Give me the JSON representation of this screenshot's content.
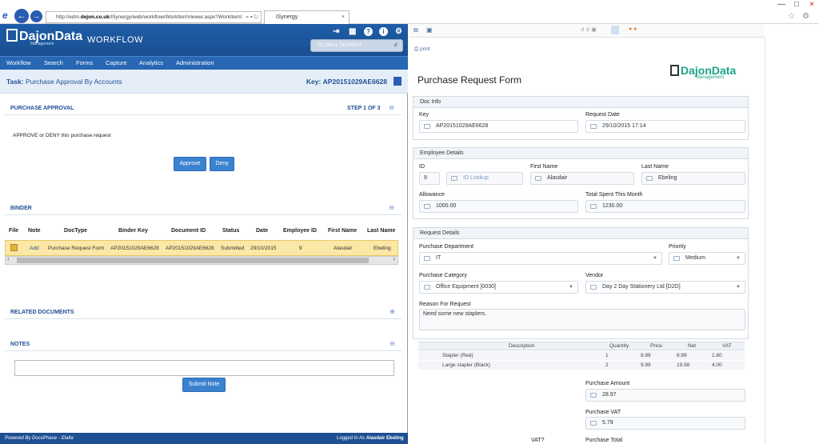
{
  "browser": {
    "url_prefix": "http://edm.",
    "url_domain": "dejon.co.uk",
    "url_rest": "/iSynergy/web/workflow/WorkItemViewer.aspx?WorkItemI",
    "search_glyph": "⌕ ▾ ↻",
    "tab_title": "iSynergy",
    "tab_close": "×"
  },
  "app": {
    "logo_text": "DajonData",
    "logo_sub": "Management",
    "module": "WORKFLOW",
    "global_search_placeholder": "GLOBAL SEARCH"
  },
  "menu": [
    "Workflow",
    "Search",
    "Forms",
    "Capture",
    "Analytics",
    "Administration"
  ],
  "task": {
    "label": "Task:",
    "name": "Purchase Approval By Accounts",
    "key_label": "Key:",
    "key_value": "AP20151029AE6628"
  },
  "approval": {
    "title": "PURCHASE APPROVAL",
    "step": "STEP 1 OF 3",
    "prompt": "APPROVE or DENY this purchase request",
    "approve": "Approve",
    "deny": "Deny"
  },
  "binder": {
    "title": "BINDER",
    "columns": [
      "File",
      "Note",
      "DocType",
      "Binder Key",
      "Document ID",
      "Status",
      "Date",
      "Employee ID",
      "First Name",
      "Last Name"
    ],
    "row": {
      "note": "Add",
      "doctype": "Purchase Request Form",
      "binder_key": "AP20151029AE6628",
      "document_id": "AP20151029AE6628",
      "status": "Submitted",
      "date": "29/10/2015",
      "employee_id": "9",
      "first_name": "Alasdair",
      "last_name": "Ebeling"
    }
  },
  "related": {
    "title": "RELATED DOCUMENTS"
  },
  "notes": {
    "title": "NOTES",
    "submit": "Submit Note"
  },
  "footer": {
    "left": "Powered By DocuPhase - iDalta",
    "right_label": "Logged In As",
    "user": "Alasdair Ebeling"
  },
  "form": {
    "print": "print",
    "title": "Purchase Request Form",
    "logo_text": "DajonData",
    "logo_sub": "Management",
    "doc_info": {
      "title": "Doc Info",
      "key_label": "Key",
      "key": "AP20151029AE6628",
      "date_label": "Request Date",
      "date": "29/10/2015 17:14"
    },
    "employee": {
      "title": "Employee Details",
      "id_label": "ID",
      "id": "9",
      "lookup": "ID Lookup",
      "first_label": "First Name",
      "first": "Alasdair",
      "last_label": "Last Name",
      "last": "Ebeling",
      "allowance_label": "Allowance",
      "allowance": "1000.00",
      "spent_label": "Total Spent This Month",
      "spent": "1230.00"
    },
    "request": {
      "title": "Request Details",
      "dept_label": "Purchase Department",
      "dept": "IT",
      "priority_label": "Priority",
      "priority": "Medium",
      "category_label": "Purchase Category",
      "category": "Office Equipment [0030]",
      "vendor_label": "Vendor",
      "vendor": "Day 2 Day Stationery Ltd [D2D]",
      "reason_label": "Reason For Request",
      "reason": "Need some new staplers."
    },
    "items": {
      "columns": [
        "Description",
        "Quantity",
        "Price",
        "Net",
        "VAT"
      ],
      "rows": [
        {
          "description": "Stapler (Red)",
          "quantity": "1",
          "price": "8.99",
          "net": "8.99",
          "vat": "1.80"
        },
        {
          "description": "Large stapler (Black)",
          "quantity": "2",
          "price": "9.99",
          "net": "19.98",
          "vat": "4.00"
        }
      ]
    },
    "amount_label": "Purchase Amount",
    "amount": "28.97",
    "vat_label": "Purchase VAT",
    "vat": "5.79",
    "vatq_label": "VAT?",
    "total_label": "Purchase Total"
  },
  "colors": {
    "brand": "#1e5da8",
    "menu": "#2767b4",
    "highlight_row": "#fbe7a6",
    "button": "#3a82cf",
    "logo_green": "#1aa38a"
  }
}
